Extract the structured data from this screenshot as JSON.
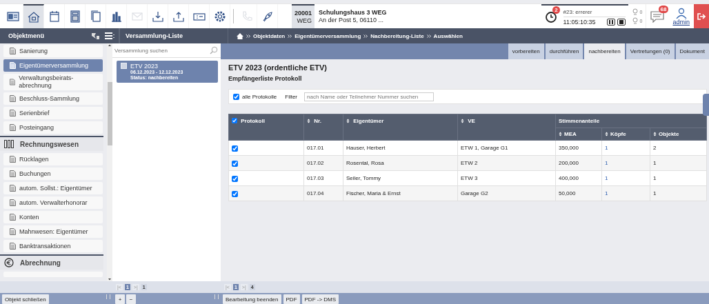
{
  "toolbar": {
    "buttons": [
      {
        "kind": "card",
        "selected": false,
        "disabled": false
      },
      {
        "kind": "house",
        "selected": true,
        "disabled": false
      },
      {
        "kind": "calendar",
        "selected": false,
        "disabled": false
      },
      {
        "kind": "calculator",
        "selected": false,
        "disabled": false
      },
      {
        "kind": "pages",
        "selected": false,
        "disabled": false
      },
      {
        "kind": "chart",
        "selected": false,
        "disabled": false
      },
      {
        "kind": "mail",
        "selected": false,
        "disabled": true
      },
      {
        "kind": "download",
        "selected": false,
        "disabled": false
      },
      {
        "kind": "upload",
        "selected": false,
        "disabled": false
      },
      {
        "kind": "ticket",
        "selected": false,
        "disabled": false
      },
      {
        "kind": "gear",
        "selected": false,
        "disabled": false
      },
      {
        "kind": "phone",
        "selected": false,
        "disabled": true
      },
      {
        "kind": "rocket",
        "selected": false,
        "disabled": false
      }
    ]
  },
  "object": {
    "number": "20001",
    "type": "WEG",
    "name": "Schulungshaus 3 WEG",
    "address": "An der Post 5, 06110 ..."
  },
  "status": {
    "reminder_badge": "2",
    "timer_title": "#23: errerer",
    "timer_time": "11:05:10:35",
    "counters": [
      "0",
      "0"
    ],
    "message_badge": "68",
    "user": "admin"
  },
  "sidebar": {
    "title": "Objektmenü",
    "items": [
      {
        "kind": "item",
        "label": "Sanierung",
        "selected": false
      },
      {
        "kind": "item",
        "label": "Eigentümerversammlung",
        "selected": true
      },
      {
        "kind": "item",
        "label": "Verwaltungsbeirats-abrechnung",
        "selected": false
      },
      {
        "kind": "item",
        "label": "Beschluss-Sammlung",
        "selected": false
      },
      {
        "kind": "item",
        "label": "Serienbrief",
        "selected": false
      },
      {
        "kind": "item",
        "label": "Posteingang",
        "selected": false
      },
      {
        "kind": "section",
        "label": "Rechnungswesen"
      },
      {
        "kind": "item",
        "label": "Rücklagen",
        "selected": false
      },
      {
        "kind": "item",
        "label": "Buchungen",
        "selected": false
      },
      {
        "kind": "item",
        "label": "autom. Sollst.: Eigentümer",
        "selected": false
      },
      {
        "kind": "item",
        "label": "autom. Verwalterhonorar",
        "selected": false
      },
      {
        "kind": "item",
        "label": "Konten",
        "selected": false
      },
      {
        "kind": "item",
        "label": "Mahnwesen: Eigentümer",
        "selected": false
      },
      {
        "kind": "item",
        "label": "Banktransaktionen",
        "selected": false
      },
      {
        "kind": "section",
        "label": "Abrechnung"
      }
    ],
    "close_button": "Objekt schließen"
  },
  "list": {
    "title": "Versammlung-Liste",
    "search": {
      "placeholder": "Versammlung suchen"
    },
    "items": [
      {
        "title": "ETV 2023",
        "dates": "06.12.2023 - 12.12.2023",
        "status": "Status: nachbereiten",
        "selected": true
      }
    ],
    "pager": {
      "first": "|<",
      "page": "1",
      "last": ">|",
      "total": "1"
    },
    "buttons": [
      "+",
      "−"
    ]
  },
  "breadcrumb": [
    "Objektdaten",
    "Eigentümerversammlung",
    "Nachbereitung-Liste",
    "Auswählen"
  ],
  "tabs": [
    {
      "label": "vorbereiten",
      "selected": false
    },
    {
      "label": "durchführen",
      "selected": false
    },
    {
      "label": "nachbereiten",
      "selected": true
    },
    {
      "label": "Vertretungen (0)",
      "selected": false
    },
    {
      "label": "Dokument",
      "selected": false
    }
  ],
  "main": {
    "title": "ETV 2023 (ordentliche ETV)",
    "subtitle": "Empfängerliste Protokoll",
    "filter": {
      "all_label": "alle Protokolle",
      "all_checked": true,
      "filter_label": "Filter",
      "placeholder": "nach Name oder Teilnehmer Nummer suchen"
    },
    "table": {
      "header_checked": true,
      "columns": [
        "Protokoll",
        "Nr.",
        "Eigentümer",
        "VE"
      ],
      "group": "Stimmenanteile",
      "subcolumns": [
        "MEA",
        "Köpfe",
        "Objekte"
      ],
      "rows": [
        {
          "checked": true,
          "nr": "017.01",
          "owner": "Hauser, Herbert",
          "ve": "ETW 1, Garage G1",
          "mea": "350,000",
          "heads": "1",
          "objects": "2"
        },
        {
          "checked": true,
          "nr": "017.02",
          "owner": "Rosental, Rosa",
          "ve": "ETW 2",
          "mea": "200,000",
          "heads": "1",
          "objects": "1"
        },
        {
          "checked": true,
          "nr": "017.03",
          "owner": "Seiler, Tommy",
          "ve": "ETW 3",
          "mea": "400,000",
          "heads": "1",
          "objects": "1"
        },
        {
          "checked": true,
          "nr": "017.04",
          "owner": "Fischer, Maria & Ernst",
          "ve": "Garage G2",
          "mea": "50,000",
          "heads": "1",
          "objects": "1"
        }
      ]
    },
    "pager": {
      "first": "|<",
      "page": "1",
      "last": ">|",
      "total": "4"
    },
    "buttons": [
      "Bearbeitung beenden",
      "PDF",
      "PDF -> DMS"
    ]
  }
}
